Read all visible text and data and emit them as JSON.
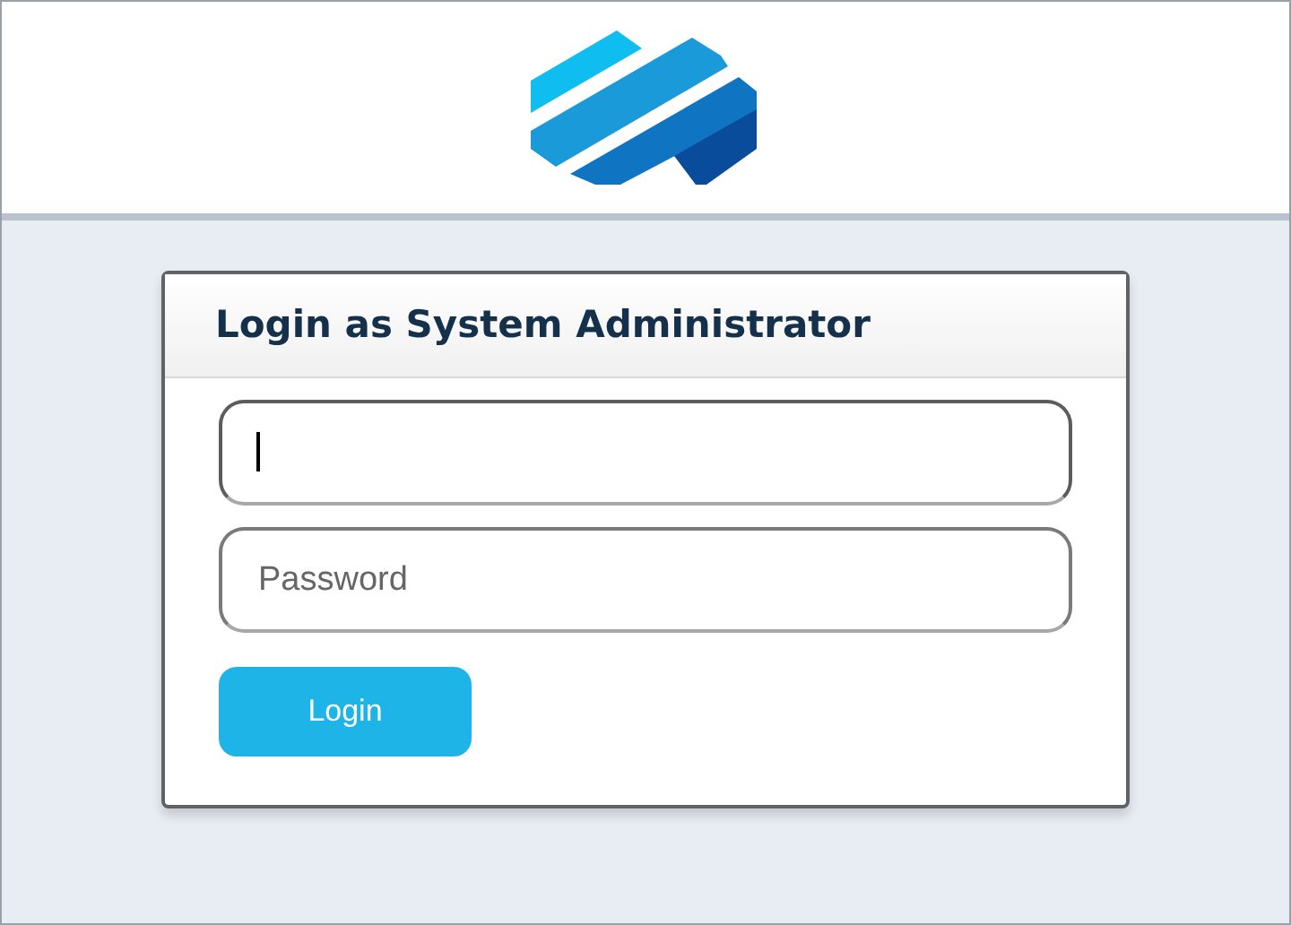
{
  "login_card": {
    "title": "Login as System Administrator",
    "fields": [
      {
        "focused": true
      },
      {
        "placeholder": "Password",
        "focused": false
      }
    ],
    "button": "Login"
  }
}
